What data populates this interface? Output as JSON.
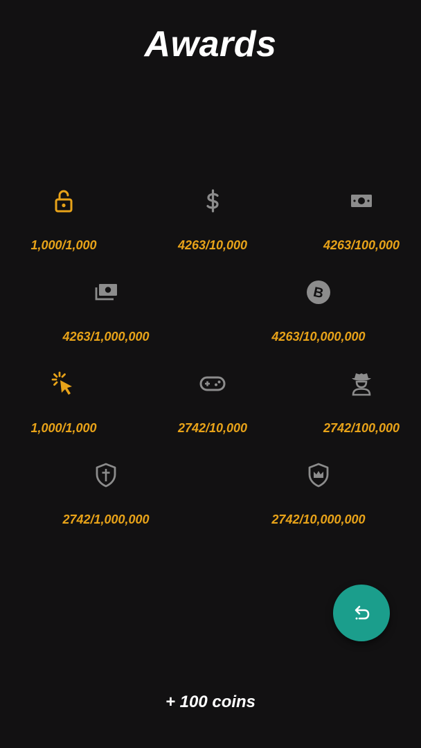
{
  "header": {
    "title": "Awards"
  },
  "colors": {
    "background": "#121112",
    "accent": "#e8a319",
    "inactive_icon": "#8c8c8c",
    "fab": "#1b9e8c"
  },
  "awards": [
    {
      "icon": "lock-open-icon",
      "progress": "1,000/1,000",
      "unlocked": true
    },
    {
      "icon": "dollar-icon",
      "progress": "4263/10,000",
      "unlocked": false
    },
    {
      "icon": "banknote-icon",
      "progress": "4263/100,000",
      "unlocked": false
    },
    {
      "icon": "money-stack-icon",
      "progress": "4263/1,000,000",
      "unlocked": false
    },
    {
      "icon": "bitcoin-icon",
      "progress": "4263/10,000,000",
      "unlocked": false
    },
    {
      "icon": "cursor-click-icon",
      "progress": "1,000/1,000",
      "unlocked": true
    },
    {
      "icon": "gamepad-icon",
      "progress": "2742/10,000",
      "unlocked": false
    },
    {
      "icon": "cowboy-icon",
      "progress": "2742/100,000",
      "unlocked": false
    },
    {
      "icon": "shield-cross-icon",
      "progress": "2742/1,000,000",
      "unlocked": false
    },
    {
      "icon": "shield-crown-icon",
      "progress": "2742/10,000,000",
      "unlocked": false
    }
  ],
  "actions": {
    "back_icon": "undo-arrow-icon"
  },
  "footer": {
    "reward": "+ 100 coins"
  }
}
